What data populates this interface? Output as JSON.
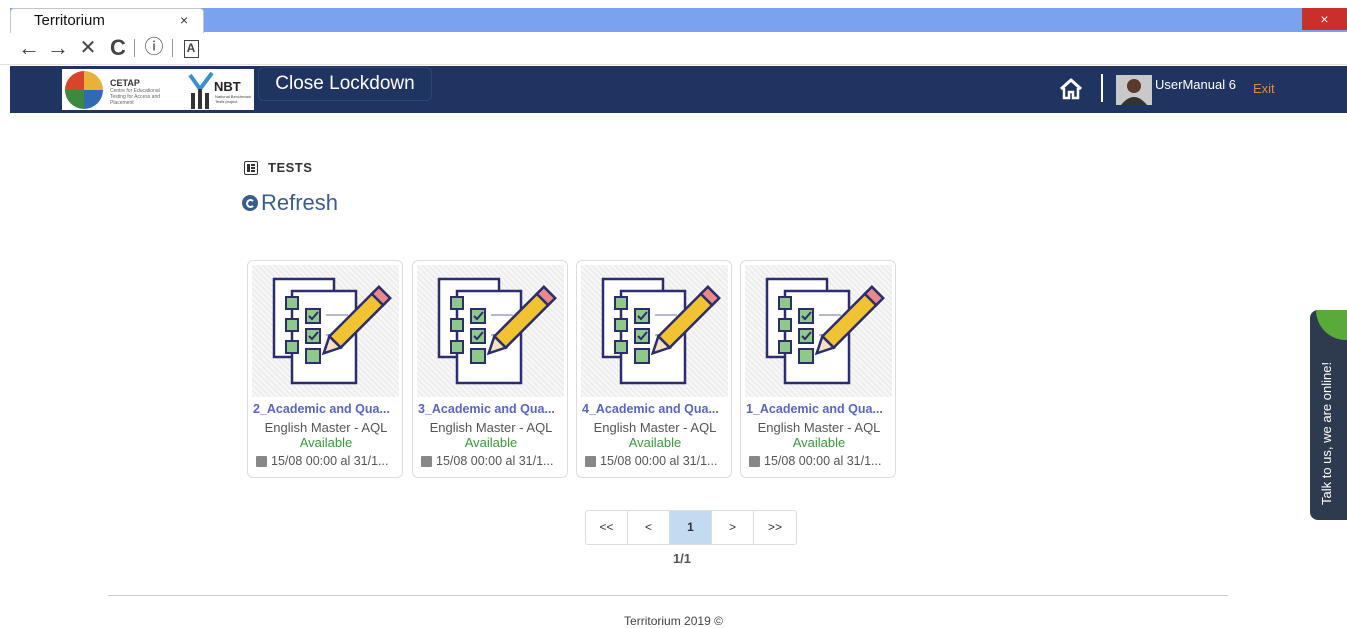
{
  "browser": {
    "tab_title": "Territorium",
    "tab_close": "×",
    "window_close": "×",
    "nav": {
      "back": "←",
      "forward": "→",
      "stop": "✕",
      "reload": "C",
      "info": "ⓘ",
      "reader": "A"
    }
  },
  "header": {
    "logo_cetap": "CETAP",
    "logo_cetap_sub": "Centre for Educational Testing for Access and Placement",
    "logo_nbt": "NBT",
    "logo_nbt_sub": "National Benchmark Tests project",
    "lockdown_label": "Close Lockdown",
    "username": "UserManual 6",
    "exit_label": "Exit",
    "accent_color": "#1f3461",
    "exit_color": "#e28a3c"
  },
  "content": {
    "section_title": "TESTS",
    "refresh_label": "Refresh",
    "cards": [
      {
        "title": "2_Academic and Qua...",
        "subtitle": "English Master - AQL",
        "status": "Available",
        "date": "15/08 00:00 al 31/1..."
      },
      {
        "title": "3_Academic and Qua...",
        "subtitle": "English Master - AQL",
        "status": "Available",
        "date": "15/08 00:00 al 31/1..."
      },
      {
        "title": "4_Academic and Qua...",
        "subtitle": "English Master - AQL",
        "status": "Available",
        "date": "15/08 00:00 al 31/1..."
      },
      {
        "title": "1_Academic and Qua...",
        "subtitle": "English Master - AQL",
        "status": "Available",
        "date": "15/08 00:00 al 31/1..."
      }
    ],
    "pager": {
      "first": "<<",
      "prev": "<",
      "current": "1",
      "next": ">",
      "last": ">>",
      "info": "1/1"
    }
  },
  "footer": {
    "text": "Territorium 2019 ©"
  },
  "chat": {
    "label": "Talk to us, we are online!"
  }
}
